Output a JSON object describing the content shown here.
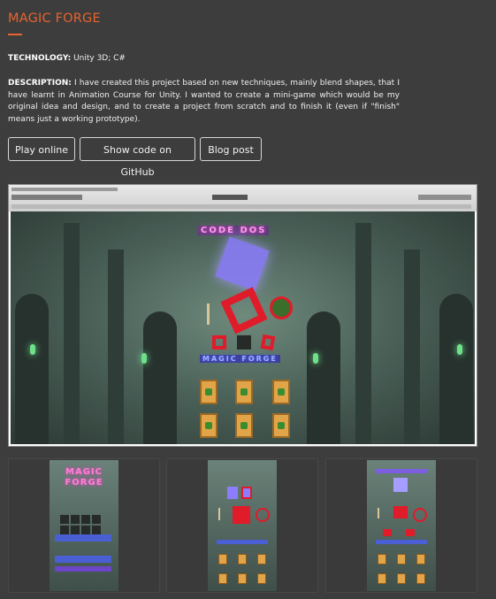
{
  "page": {
    "title": "MAGIC FORGE",
    "technology_label": "TECHNOLOGY:",
    "technology_value": "Unity 3D; C#",
    "description_label": "DESCRIPTION:",
    "description_text": "I have created this project based on new techniques, mainly blend shapes, that I have learnt in Animation Course for Unity. I wanted to create a mini-game which would be my original idea and design, and to create a project from scratch and to finish it (even if \"finish\" means just a working prototype).",
    "accent_color": "#e8632d"
  },
  "buttons": {
    "play": "Play online",
    "github": "Show code on GitHub",
    "blog": "Blog post"
  },
  "screenshot": {
    "scene_text_top": "CODE DOS",
    "scene_text_mid": "MAGIC FORGE"
  },
  "thumbnails": [
    {
      "line1": "MAGIC",
      "line2": "FORGE"
    },
    {
      "line1": "",
      "line2": ""
    },
    {
      "line1": "",
      "line2": ""
    }
  ]
}
